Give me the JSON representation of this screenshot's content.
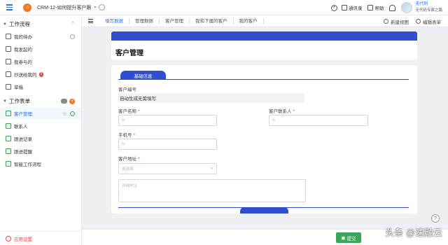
{
  "topbar": {
    "app_title": "CRM-12-如何提升客户跟",
    "home_glyph": "⌂",
    "address_book": "通讯录",
    "help": "帮助",
    "user_name": "无代码",
    "user_subtitle": "无代码专家之路"
  },
  "sidebar": {
    "workflow_title": "工作流程",
    "workflow_items": [
      {
        "label": "我的待办"
      },
      {
        "label": "我发起的"
      },
      {
        "label": "我参与的"
      },
      {
        "label": "抄送给我的",
        "badge": "1"
      },
      {
        "label": "草稿"
      }
    ],
    "forms_title": "工作表单",
    "form_items": [
      {
        "label": "客户管理"
      },
      {
        "label": "联系人"
      },
      {
        "label": "跟进记录"
      },
      {
        "label": "跟进提醒"
      },
      {
        "label": "智能工作流程"
      }
    ],
    "app_settings": "应用设置"
  },
  "tabs": {
    "items": [
      "填写数据",
      "管理数据",
      "客户管理",
      "我和下属的客户",
      "我的客户"
    ],
    "new_view": "新建视图",
    "edit_form": "编辑表单"
  },
  "form": {
    "title": "客户管理",
    "group_title": "基础信息",
    "fields": {
      "customer_no_label": "客户编号",
      "customer_no_value": "自动生成无需填写",
      "customer_name_label": "客户名称",
      "contact_label": "客户联系人",
      "phone_label": "手机号",
      "address_label": "客户地址",
      "input_placeholder": "fx.",
      "select_placeholder": "请选择",
      "detail_placeholder": "详细地址",
      "required_mark": "*"
    }
  },
  "footer": {
    "submit": "提交"
  },
  "watermark": "头条 @速融云",
  "colors": {
    "accent_blue": "#2f4fd0",
    "link_blue": "#2f6fe0",
    "submit_green": "#3aa657",
    "home_orange": "#f07a2a",
    "required_red": "#ef4444"
  }
}
